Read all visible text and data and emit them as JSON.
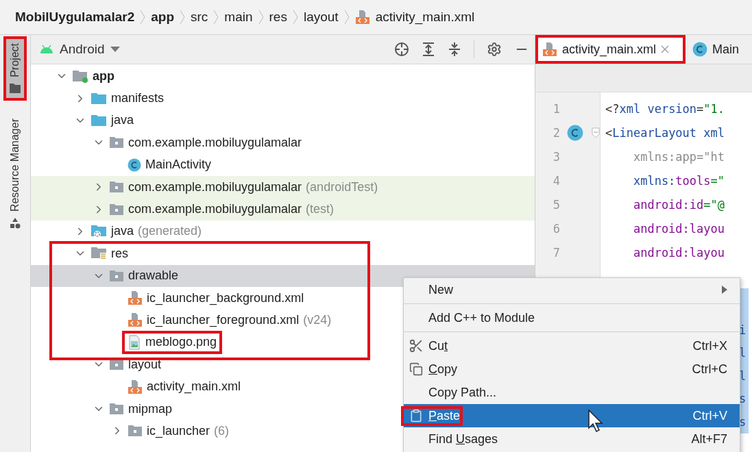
{
  "breadcrumbs": [
    {
      "label": "MobilUygulamalar2",
      "bold": true
    },
    {
      "label": "app",
      "bold": true
    },
    {
      "label": "src",
      "bold": false
    },
    {
      "label": "main",
      "bold": false
    },
    {
      "label": "res",
      "bold": false
    },
    {
      "label": "layout",
      "bold": false
    },
    {
      "label": "activity_main.xml",
      "bold": false
    }
  ],
  "tool_strip": [
    {
      "label": "Project",
      "selected": true,
      "highlighted": true
    },
    {
      "label": "Resource Manager",
      "selected": false,
      "highlighted": false
    }
  ],
  "project_panel": {
    "view": "Android",
    "tree": [
      {
        "label": "app",
        "bold": true,
        "kind": "module",
        "expanded": true,
        "selected": false,
        "children": [
          {
            "label": "manifests",
            "kind": "folder",
            "expanded": false,
            "selected": false
          },
          {
            "label": "java",
            "kind": "folder",
            "expanded": true,
            "selected": false,
            "children": [
              {
                "label": "com.example.mobiluygulamalar",
                "kind": "package",
                "expanded": true,
                "selected": false,
                "children": [
                  {
                    "label": "MainActivity",
                    "kind": "class",
                    "selected": false
                  }
                ]
              },
              {
                "label": "com.example.mobiluygulamalar",
                "note": "(androidTest)",
                "test": true,
                "kind": "package",
                "expanded": false,
                "selected": false
              },
              {
                "label": "com.example.mobiluygulamalar",
                "note": "(test)",
                "test": true,
                "kind": "package",
                "expanded": false,
                "selected": false
              }
            ]
          },
          {
            "label": "java",
            "note": "(generated)",
            "kind": "generated",
            "expanded": false,
            "selected": false
          },
          {
            "label": "res",
            "kind": "res",
            "expanded": true,
            "selected": false,
            "highlighted": true,
            "children": [
              {
                "label": "drawable",
                "kind": "package",
                "expanded": true,
                "selected": true,
                "children": [
                  {
                    "label": "ic_launcher_background.xml",
                    "kind": "xml",
                    "selected": false
                  },
                  {
                    "label": "ic_launcher_foreground.xml",
                    "note": "(v24)",
                    "kind": "xml",
                    "selected": false
                  },
                  {
                    "label": "meblogo.png",
                    "kind": "image",
                    "selected": false,
                    "highlighted": true
                  }
                ]
              },
              {
                "label": "layout",
                "kind": "package",
                "expanded": true,
                "selected": false,
                "children": [
                  {
                    "label": "activity_main.xml",
                    "kind": "xml",
                    "selected": false
                  }
                ]
              },
              {
                "label": "mipmap",
                "kind": "package",
                "expanded": true,
                "selected": false,
                "children": [
                  {
                    "label": "ic_launcher",
                    "note": "(6)",
                    "kind": "package",
                    "expanded": false,
                    "selected": false
                  }
                ]
              }
            ]
          }
        ]
      }
    ]
  },
  "editor": {
    "tabs": [
      {
        "label": "activity_main.xml",
        "kind": "xml",
        "selected": true,
        "highlighted": true
      },
      {
        "label": "Main",
        "kind": "class",
        "selected": false,
        "highlighted": false
      }
    ],
    "lines": [
      {
        "number": "1",
        "kind": "plain",
        "segments": [
          {
            "text": "<?",
            "kind": "punct"
          },
          {
            "text": "xml version",
            "kind": "tag"
          },
          {
            "text": "=",
            "kind": "punct"
          },
          {
            "text": "\"1.",
            "kind": "value"
          }
        ]
      },
      {
        "number": "2",
        "kind": "marked",
        "segments": [
          {
            "text": "<",
            "kind": "punct"
          },
          {
            "text": "LinearLayout xml",
            "kind": "tag"
          }
        ]
      },
      {
        "number": "3",
        "kind": "plain",
        "segments": [
          {
            "text": "    xmlns:app=\"ht",
            "kind": "dim"
          }
        ]
      },
      {
        "number": "4",
        "kind": "plain",
        "segments": [
          {
            "text": "    xmlns:",
            "kind": "tag"
          },
          {
            "text": "tools",
            "kind": "attr"
          },
          {
            "text": "=\"",
            "kind": "value"
          }
        ]
      },
      {
        "number": "5",
        "kind": "plain",
        "segments": [
          {
            "text": "    android:id",
            "kind": "attr"
          },
          {
            "text": "=\"@",
            "kind": "value"
          }
        ]
      },
      {
        "number": "6",
        "kind": "plain",
        "segments": [
          {
            "text": "    android:layou",
            "kind": "attr"
          }
        ]
      },
      {
        "number": "7",
        "kind": "plain",
        "segments": [
          {
            "text": "    android:layou",
            "kind": "attr"
          }
        ]
      }
    ],
    "selected_fragments": [
      "i",
      "l",
      "l",
      "s",
      "s"
    ]
  },
  "context_menu": [
    {
      "kind": "submenu",
      "parts": [
        {
          "text": "New",
          "underlined": false
        }
      ],
      "selected": false
    },
    {
      "kind": "separator"
    },
    {
      "kind": "plain",
      "parts": [
        {
          "text": "Add C++ to Module",
          "underlined": false
        }
      ],
      "selected": false
    },
    {
      "kind": "separator"
    },
    {
      "kind": "cut",
      "parts": [
        {
          "text": "Cu",
          "underlined": false
        },
        {
          "text": "t",
          "underlined": true
        }
      ],
      "shortcut": "Ctrl+X",
      "selected": false
    },
    {
      "kind": "copy",
      "parts": [
        {
          "text": "C",
          "underlined": true
        },
        {
          "text": "opy",
          "underlined": false
        }
      ],
      "shortcut": "Ctrl+C",
      "selected": false
    },
    {
      "kind": "plain",
      "parts": [
        {
          "text": "Copy Path...",
          "underlined": false
        }
      ],
      "selected": false
    },
    {
      "kind": "paste",
      "parts": [
        {
          "text": "P",
          "underlined": true
        },
        {
          "text": "aste",
          "underlined": false
        }
      ],
      "shortcut": "Ctrl+V",
      "selected": true,
      "highlighted": true
    },
    {
      "kind": "plain",
      "parts": [
        {
          "text": "Find ",
          "underlined": false
        },
        {
          "text": "U",
          "underlined": true
        },
        {
          "text": "sages",
          "underlined": false
        }
      ],
      "shortcut": "Alt+F7",
      "selected": false
    }
  ]
}
